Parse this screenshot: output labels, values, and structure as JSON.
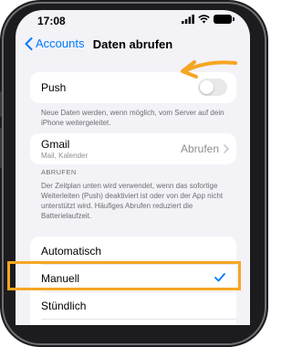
{
  "status_bar": {
    "time": "17:08"
  },
  "nav": {
    "back_label": "Accounts",
    "title": "Daten abrufen"
  },
  "push": {
    "label": "Push",
    "enabled": false,
    "description": "Neue Daten werden, wenn möglich, vom Server auf dein iPhone weitergeleitet."
  },
  "gmail": {
    "title": "Gmail",
    "subtitle": "Mail, Kalender",
    "value": "Abrufen"
  },
  "abrufen_section": {
    "header": "ABRUFEN",
    "description": "Der Zeitplan unten wird verwendet, wenn das sofortige Weiterleiten (Push) deaktiviert ist oder von der App nicht unterstützt wird. Häufiges Abrufen reduziert die Batterielaufzeit."
  },
  "schedule_options": [
    {
      "label": "Automatisch",
      "selected": false
    },
    {
      "label": "Manuell",
      "selected": true
    },
    {
      "label": "Stündlich",
      "selected": false
    }
  ],
  "colors": {
    "accent": "#007aff",
    "annotation": "#f5a623",
    "background": "#f2f2f7"
  },
  "icons": [
    "cellular-signal-icon",
    "wifi-icon",
    "battery-icon",
    "back-chevron-icon",
    "chevron-right-icon",
    "checkmark-icon",
    "annotation-arrow"
  ]
}
